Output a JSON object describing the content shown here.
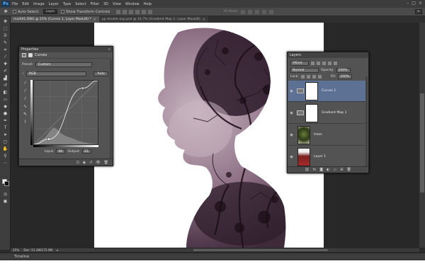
{
  "menubar": {
    "logo": "Ps",
    "items": [
      "File",
      "Edit",
      "Image",
      "Layer",
      "Type",
      "Select",
      "Filter",
      "3D",
      "View",
      "Window",
      "Help"
    ]
  },
  "options": {
    "auto_select_label": "Auto-Select:",
    "auto_select_value": "Layer",
    "show_transform_label": "Show Transform Controls",
    "mode_3d_label": "3D Mode:",
    "workspace_value": ""
  },
  "tabs": [
    {
      "label": "mulh01.DNG @ 25% (Curves 1, Layer Mask/8) *",
      "active": true
    },
    {
      "label": "pp double exp.psd @ 16.7% (Gradient Map 1, Layer Mask/8)",
      "active": false
    }
  ],
  "properties": {
    "panel_title": "Properties",
    "header": "Curves",
    "preset_label": "Preset:",
    "preset_value": "Custom",
    "channel_value": "RGB",
    "auto_label": "Auto",
    "input_label": "Input:",
    "input_value": "60",
    "output_label": "Output:",
    "output_value": "21"
  },
  "curve": {
    "points": [
      [
        0,
        0
      ],
      [
        60,
        21
      ],
      [
        195,
        225
      ],
      [
        255,
        255
      ]
    ]
  },
  "layers": {
    "panel_title": "Layers",
    "kind_value": "Kind",
    "blend_mode": "Normal",
    "opacity_label": "Opacity:",
    "opacity_value": "100%",
    "lock_label": "Lock:",
    "fill_label": "Fill:",
    "fill_value": "100%",
    "items": [
      {
        "name": "Curves 1",
        "selected": true
      },
      {
        "name": "Gradient Map 1",
        "selected": false
      },
      {
        "name": "trees",
        "selected": false
      },
      {
        "name": "Layer 1",
        "selected": false
      }
    ]
  },
  "status": {
    "zoom": "25%",
    "doc_size": "Doc: 51.3M/175.0M"
  },
  "timeline_label": "Timeline",
  "colors": {
    "selected_layer": "#5c7194",
    "portrait_tint": "#5a3f52"
  }
}
